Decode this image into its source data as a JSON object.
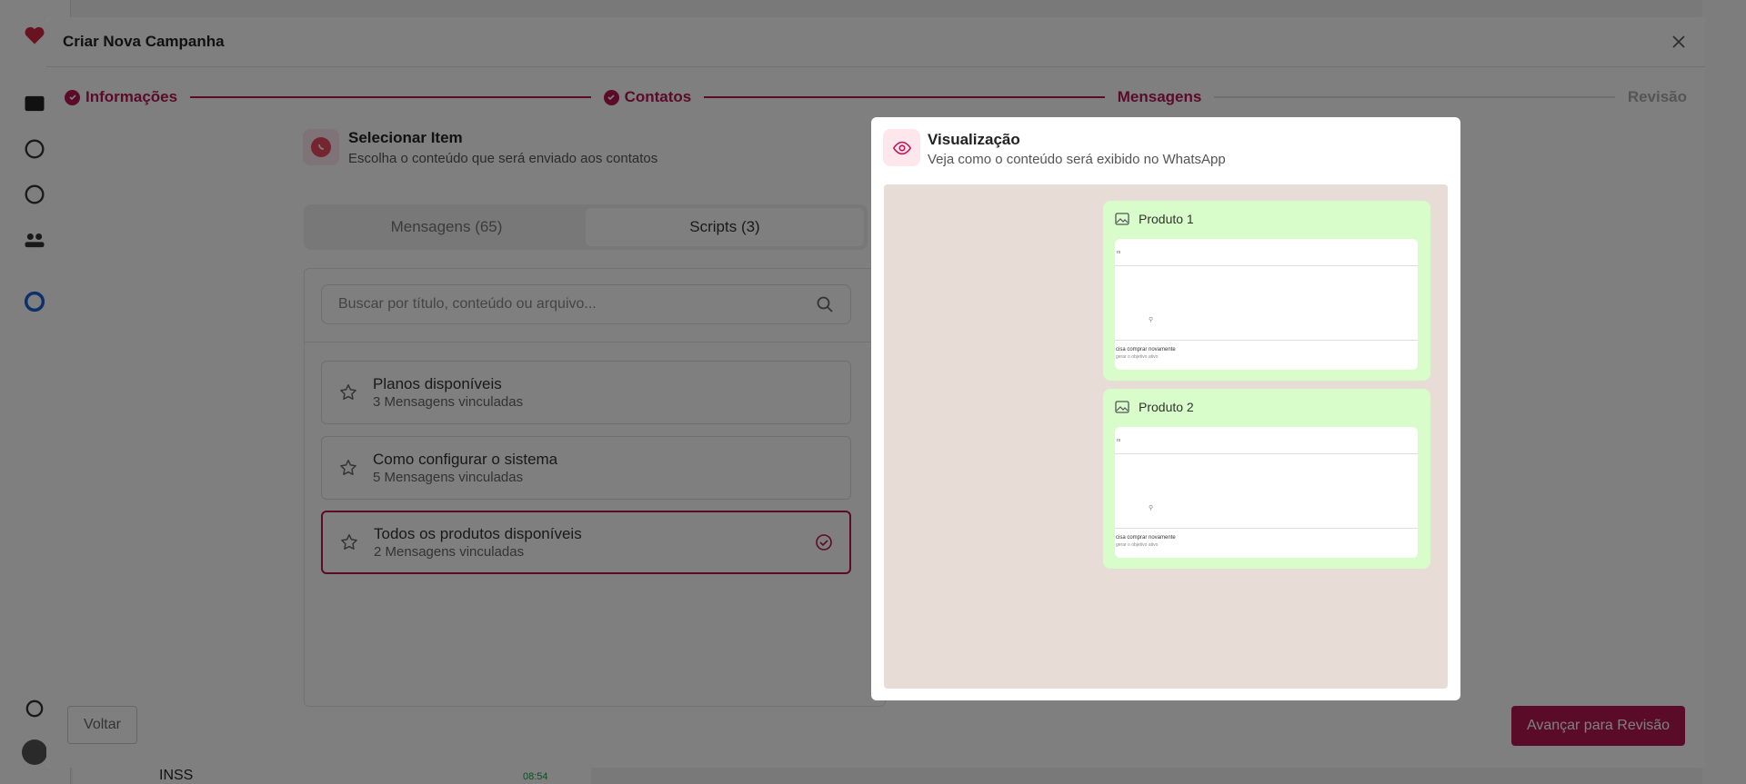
{
  "modal": {
    "title": "Criar Nova Campanha"
  },
  "steps": [
    {
      "label": "Informações",
      "state": "done"
    },
    {
      "label": "Contatos",
      "state": "done"
    },
    {
      "label": "Mensagens",
      "state": "active"
    },
    {
      "label": "Revisão",
      "state": "pending"
    }
  ],
  "select_item": {
    "title": "Selecionar Item",
    "subtitle": "Escolha o conteúdo que será enviado aos contatos"
  },
  "tabs": [
    {
      "label": "Mensagens (65)",
      "selected": false
    },
    {
      "label": "Scripts (3)",
      "selected": true
    }
  ],
  "search": {
    "placeholder": "Buscar por título, conteúdo ou arquivo..."
  },
  "items": [
    {
      "title": "Planos disponíveis",
      "subtitle": "3 Mensagens vinculadas",
      "selected": false
    },
    {
      "title": "Como configurar o sistema",
      "subtitle": "5 Mensagens vinculadas",
      "selected": false
    },
    {
      "title": "Todos os produtos disponíveis",
      "subtitle": "2 Mensagens vinculadas",
      "selected": true
    }
  ],
  "footer": {
    "back_label": "Voltar",
    "next_label": "Avançar para Revisão"
  },
  "preview": {
    "title": "Visualização",
    "subtitle": "Veja como o conteúdo será exibido no WhatsApp",
    "messages": [
      {
        "label": "Produto 1",
        "thumb_top": "rs",
        "thumb_line1": "cisa comprar novamente",
        "thumb_line2": "gerar o objetivo ativo"
      },
      {
        "label": "Produto 2",
        "thumb_top": "rs",
        "thumb_line1": "cisa comprar novamente",
        "thumb_line2": "gerar o objetivo ativo"
      }
    ]
  },
  "background": {
    "chat_name": "INSS",
    "chat_time": "08:54"
  },
  "colors": {
    "accent": "#b5174f",
    "bubble": "#d9fccb",
    "chat_bg": "#e7ddd6"
  },
  "icons": [
    "check-circle-icon",
    "close-icon",
    "whatsapp-icon",
    "search-icon",
    "star-icon",
    "check-circle-outline-icon",
    "eye-icon",
    "image-icon"
  ]
}
